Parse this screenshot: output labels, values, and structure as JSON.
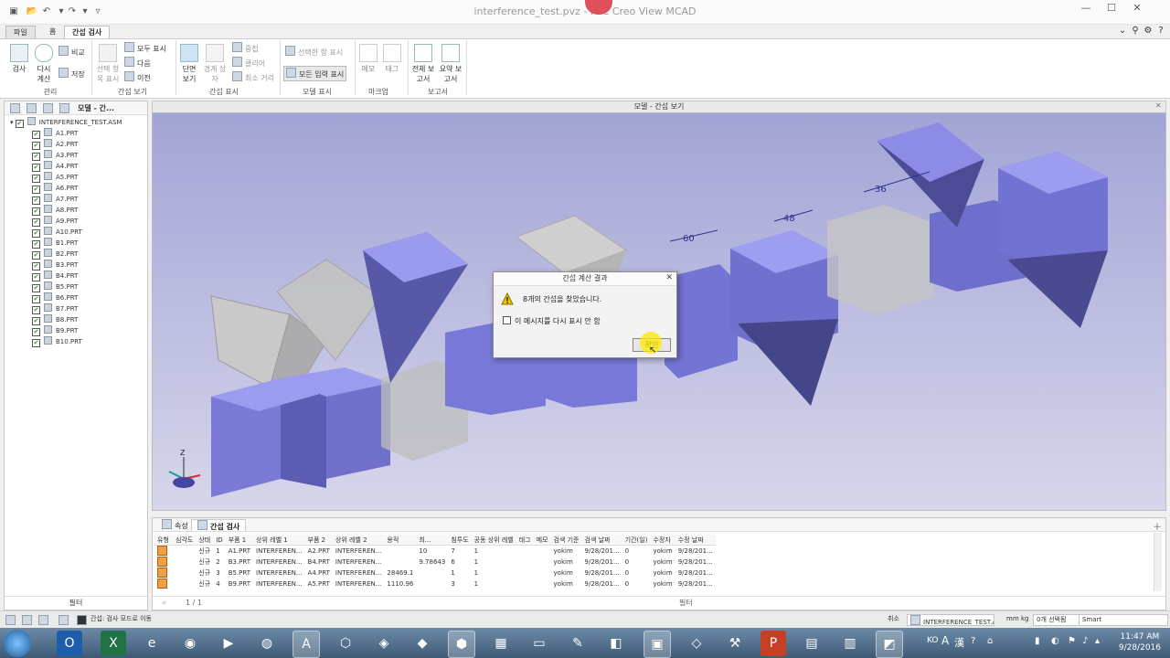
{
  "window": {
    "title": "interference_test.pvz - PTC Creo View MCAD"
  },
  "ribbon": {
    "tabs": [
      "파일",
      "홈",
      "간섭 검사"
    ],
    "buttons": {
      "check": "검사",
      "recalc": "다시 계산",
      "compare": "비교",
      "save": "저장",
      "show_selected": "선택 항목 표시",
      "show_all": "모두 표시",
      "next": "다음",
      "prev": "이전",
      "section_view": "단면 보기",
      "bbox": "경계 상자",
      "overlap": "중첩",
      "clearance": "클리어",
      "min_distance": "최소 거리",
      "show_selected_only": "선택한 항 표시",
      "show_all_input": "모든 입력 표시",
      "memo": "메모",
      "tag": "태그",
      "full_report": "전체 보고서",
      "summary_report": "요약 보고서"
    },
    "groups": [
      "관리",
      "간섭 보기",
      "간섭 표시",
      "모델 표시",
      "마크업",
      "보고서"
    ]
  },
  "tree": {
    "header_tab": "모델 - 간...",
    "root": "INTERFERENCE_TEST.ASM",
    "items": [
      "A1.PRT",
      "A2.PRT",
      "A3.PRT",
      "A4.PRT",
      "A5.PRT",
      "A6.PRT",
      "A7.PRT",
      "A8.PRT",
      "A9.PRT",
      "A10.PRT",
      "B1.PRT",
      "B2.PRT",
      "B3.PRT",
      "B4.PRT",
      "B5.PRT",
      "B6.PRT",
      "B7.PRT",
      "B8.PRT",
      "B9.PRT",
      "B10.PRT"
    ],
    "footer": "필터"
  },
  "viewport": {
    "title": "모델 - 간섭 보기",
    "dimension_labels": [
      "60",
      "48",
      "36"
    ],
    "axis_label": "Z"
  },
  "dialog": {
    "title": "간섭 계산 결과",
    "message": "8개의 간섭을 찾았습니다.",
    "checkbox_label": "이 메시지를 다시 표시 안 함",
    "ok_label": "확인"
  },
  "bottom_panel": {
    "tabs": [
      "속성",
      "간섭 검사"
    ],
    "columns": [
      "유형",
      "심각도",
      "상태",
      "ID",
      "부품 1",
      "상위 레벨 1",
      "부품 2",
      "상위 레벨 2",
      "용적",
      "최...",
      "침투도",
      "공동 상위 레벨",
      "태그",
      "메모",
      "검색 기준",
      "검색 날짜",
      "기간(일)",
      "수정자",
      "수정 날짜"
    ],
    "rows": [
      [
        "",
        "",
        "신규",
        "1",
        "A1.PRT",
        "INTERFEREN...",
        "A2.PRT",
        "INTERFEREN...",
        "",
        "10",
        "7",
        "1",
        "",
        "",
        "yokim",
        "9/28/201...",
        "0",
        "yokim",
        "9/28/201..."
      ],
      [
        "",
        "",
        "신규",
        "2",
        "B3.PRT",
        "INTERFEREN...",
        "B4.PRT",
        "INTERFEREN...",
        "",
        "9.78643",
        "6",
        "1",
        "",
        "",
        "yokim",
        "9/28/201...",
        "0",
        "yokim",
        "9/28/201..."
      ],
      [
        "",
        "",
        "신규",
        "3",
        "B5.PRT",
        "INTERFEREN...",
        "A4.PRT",
        "INTERFEREN...",
        "28469.1",
        "",
        "1",
        "1",
        "",
        "",
        "yokim",
        "9/28/201...",
        "0",
        "yokim",
        "9/28/201..."
      ],
      [
        "",
        "",
        "신규",
        "4",
        "B9.PRT",
        "INTERFEREN...",
        "A5.PRT",
        "INTERFEREN...",
        "1110.96",
        "",
        "3",
        "1",
        "",
        "",
        "yokim",
        "9/28/201...",
        "0",
        "yokim",
        "9/28/201..."
      ]
    ],
    "pager": "1 / 1",
    "filter": "필터"
  },
  "statusbar": {
    "mode": "간섭: 검사 모드로 이동",
    "cancel": "취소",
    "model": "INTERFERENCE_TEST.ASM",
    "unit_mm": "mm",
    "unit_kg": "kg",
    "selection": "0개 선택됨",
    "select_mode": "Smart"
  },
  "taskbar": {
    "time": "11:47 AM",
    "date": "9/28/2016",
    "ime": "KO",
    "ime_a": "A",
    "ime_han": "漢"
  },
  "colors": {
    "part_blue": "#8e8ef0",
    "part_gray": "#bdbdbd",
    "viewport_top": "#a2a4d6",
    "ribbon_bg": "#ffffff"
  }
}
